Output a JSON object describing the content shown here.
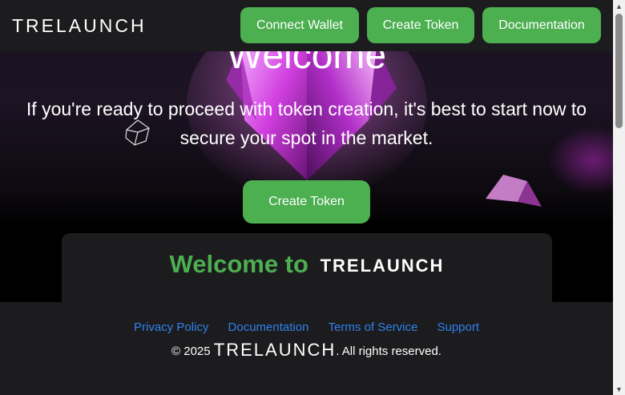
{
  "navbar": {
    "logo": "TRELAUNCH",
    "buttons": {
      "connect_wallet": "Connect Wallet",
      "create_token": "Create Token",
      "documentation": "Documentation"
    }
  },
  "hero": {
    "welcome": "Welcome",
    "text": "If you're ready to proceed with token creation, it's best to start now to secure your spot in the market.",
    "button": "Create Token"
  },
  "card": {
    "welcome_to": "Welcome to",
    "brand": "TRELAUNCH"
  },
  "footer": {
    "links": {
      "privacy": "Privacy Policy",
      "documentation": "Documentation",
      "terms": "Terms of Service",
      "support": "Support"
    },
    "copyright_prefix": "© 2025",
    "brand": "TRELAUNCH",
    "copyright_suffix": ". All rights reserved."
  },
  "colors": {
    "accent": "#4caf50",
    "link": "#2f80ed",
    "surface": "#1c1c1e"
  }
}
